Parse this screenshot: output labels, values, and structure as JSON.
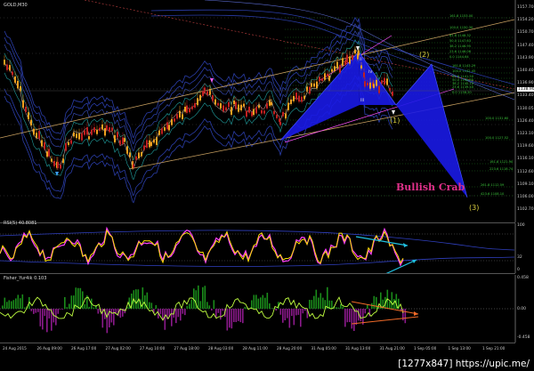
{
  "main_chart": {
    "symbol_label": "GOLD,M30",
    "pattern_label": "Bullish Crab",
    "wave_labels": [
      "(1)",
      "(2)",
      "(3)"
    ],
    "pivot_labels": [
      "ii",
      "iii",
      "iv"
    ],
    "price_ticks": [
      "1157.70",
      "1154.20",
      "1150.70",
      "1147.40",
      "1143.90",
      "1140.40",
      "1136.90",
      "1133.40",
      "1130.05",
      "1126.40",
      "1123.10",
      "1119.60",
      "1116.10",
      "1112.60",
      "1109.10",
      "1106.00",
      "1102.70"
    ],
    "current_price": "1138.90",
    "fib_levels": [
      "161.8 1153.00",
      "100.0 1150.30",
      "61.8 1148.32",
      "50.0 1147.63",
      "38.2 1146.95",
      "23.6 1146.06",
      "0.0 1144.64",
      "161.8 1143.29",
      "100.0 1142.45",
      "61.8 1141.50",
      "50.0 1140.80",
      "38.2 1140.10",
      "23.6 1139.40",
      "0.0 1138.20",
      "100.0 1131.60",
      "100.0 1127.52",
      "161.8 1121.90",
      "223.6 1118.74",
      "261.8 1112.59",
      "423.6 1108.10"
    ],
    "colors": {
      "pattern_fill": "#1a1ae6",
      "channel": "#c8a060",
      "bands": "#2a3da8",
      "inner": "#20a0a0",
      "candle_up": "#f0a020",
      "candle_dn": "#c02020"
    }
  },
  "rsi": {
    "label": "RSI(5) 40.8081",
    "ticks": [
      "100",
      "32",
      "0"
    ],
    "colors": {
      "line": "#ffe000",
      "ma": "#ff40ff",
      "arrow": "#20c0e0"
    }
  },
  "fisher": {
    "label": "Fisher_Yur4ik 0.103",
    "ticks": [
      "0.458",
      "0.00",
      "-0.458"
    ],
    "colors": {
      "pos": "#1a8c1a",
      "neg": "#8c1a8c",
      "line": "#c0ff40",
      "arrow": "#f06a28"
    }
  },
  "x_axis": [
    "24 Aug 2015",
    "26 Aug 09:00",
    "26 Aug 17:00",
    "27 Aug 02:00",
    "27 Aug 10:00",
    "27 Aug 18:00",
    "28 Aug 03:00",
    "28 Aug 11:00",
    "28 Aug 20:00",
    "31 Aug 05:00",
    "31 Aug 13:00",
    "31 Aug 21:00",
    "1 Sep 05:00",
    "1 Sep 13:00",
    "1 Sep 21:00"
  ],
  "watermark": "[1277x847] https://upic.me/"
}
